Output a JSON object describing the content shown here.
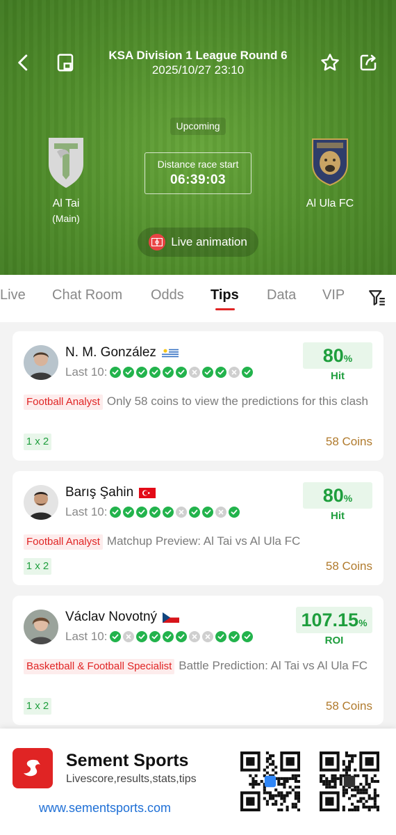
{
  "header": {
    "league_round": "KSA Division 1 League Round 6",
    "datetime": "2025/10/27 23:10",
    "status": "Upcoming",
    "countdown_label": "Distance race start",
    "countdown_value": "06:39:03",
    "live_animation_label": "Live animation",
    "home": {
      "name": "Al Tai",
      "sub": "(Main)"
    },
    "away": {
      "name": "Al Ula FC"
    }
  },
  "tabs": [
    {
      "label": "Live"
    },
    {
      "label": "Chat Room"
    },
    {
      "label": "Odds"
    },
    {
      "label": "Tips",
      "active": true
    },
    {
      "label": "Data"
    },
    {
      "label": "VIP"
    }
  ],
  "tips": [
    {
      "expert": "N. M. González",
      "country": "Uruguay",
      "last10_label": "Last 10:",
      "last10": [
        "W",
        "W",
        "W",
        "W",
        "W",
        "W",
        "L",
        "W",
        "W",
        "L",
        "W"
      ],
      "stat_value": "80",
      "stat_unit": "%",
      "stat_label": "Hit",
      "tag": "Football Analyst",
      "text": "Only 58 coins to view the predictions for this clash",
      "market": "1 x 2",
      "price": "58 Coins"
    },
    {
      "expert": "Barış Şahin",
      "country": "Turkey",
      "last10_label": "Last 10:",
      "last10": [
        "W",
        "W",
        "W",
        "W",
        "W",
        "L",
        "W",
        "W",
        "L",
        "W"
      ],
      "stat_value": "80",
      "stat_unit": "%",
      "stat_label": "Hit",
      "tag": "Football Analyst",
      "text": "Matchup Preview: Al Tai vs Al Ula FC",
      "market": "1 x 2",
      "price": "58 Coins"
    },
    {
      "expert": "Václav Novotný",
      "country": "Czechia",
      "last10_label": "Last 10:",
      "last10": [
        "W",
        "L",
        "W",
        "W",
        "W",
        "W",
        "L",
        "L",
        "W",
        "W",
        "W"
      ],
      "stat_value": "107.15",
      "stat_unit": "%",
      "stat_label": "ROI",
      "tag": "Basketball & Football Specialist",
      "text": "Battle Prediction: Al Tai vs Al Ula FC",
      "market": "1 x 2",
      "price": "58 Coins"
    }
  ],
  "banner": {
    "app_name": "Sement Sports",
    "tagline": "Livescore,results,stats,tips",
    "url": "www.sementsports.com"
  }
}
